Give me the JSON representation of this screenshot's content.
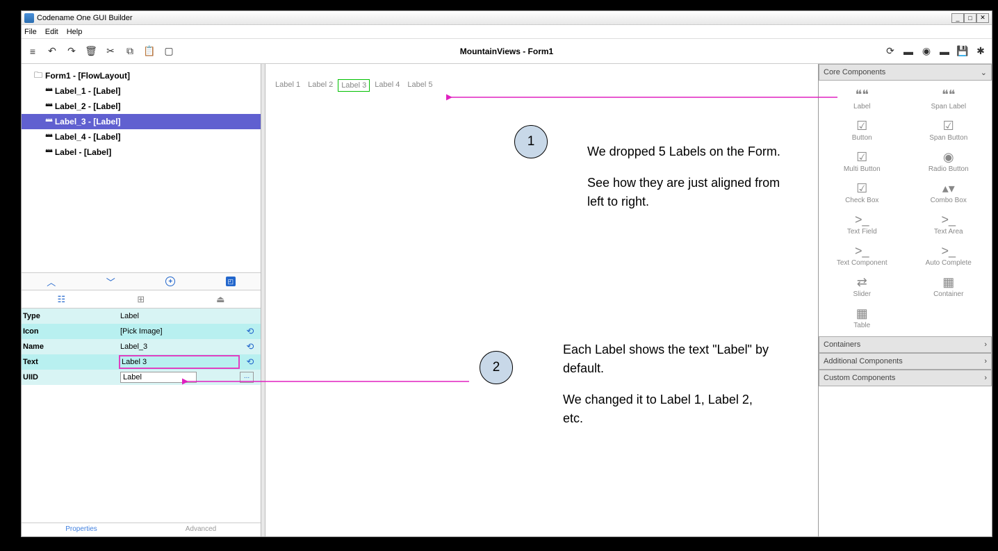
{
  "window": {
    "title": "Codename One GUI Builder"
  },
  "menu": {
    "file": "File",
    "edit": "Edit",
    "help": "Help"
  },
  "toolbar_center": "MountainViews - Form1",
  "tree": {
    "root": "Form1 - [FlowLayout]",
    "items": [
      "Label_1 - [Label]",
      "Label_2 - [Label]",
      "Label_3 - [Label]",
      "Label_4 - [Label]",
      "Label - [Label]"
    ],
    "selected_index": 2
  },
  "properties": {
    "rows": [
      {
        "key": "Type",
        "val": "Label"
      },
      {
        "key": "Icon",
        "val": "[Pick Image]",
        "action": true
      },
      {
        "key": "Name",
        "val": "Label_3",
        "action": true
      },
      {
        "key": "Text",
        "val": "Label 3",
        "boxed": true,
        "action": true
      },
      {
        "key": "UIID",
        "val_input": "Label",
        "dots": true
      }
    ],
    "footer": {
      "active": "Properties",
      "inactive": "Advanced"
    }
  },
  "canvas": {
    "labels": [
      "Label 1",
      "Label 2",
      "Label 3",
      "Label 4",
      "Label 5"
    ],
    "selected_index": 2
  },
  "palette": {
    "categories": [
      {
        "name": "Core Components",
        "open": true,
        "items": [
          {
            "label": "Label",
            "icon": "❝❝"
          },
          {
            "label": "Span Label",
            "icon": "❝❝"
          },
          {
            "label": "Button",
            "icon": "☑"
          },
          {
            "label": "Span Button",
            "icon": "☑"
          },
          {
            "label": "Multi Button",
            "icon": "☑"
          },
          {
            "label": "Radio Button",
            "icon": "◉"
          },
          {
            "label": "Check Box",
            "icon": "☑"
          },
          {
            "label": "Combo Box",
            "icon": "▴▾"
          },
          {
            "label": "Text Field",
            "icon": ">_"
          },
          {
            "label": "Text Area",
            "icon": ">_"
          },
          {
            "label": "Text Component",
            "icon": ">_"
          },
          {
            "label": "Auto Complete",
            "icon": ">_"
          },
          {
            "label": "Slider",
            "icon": "⇄"
          },
          {
            "label": "Container",
            "icon": "▦"
          },
          {
            "label": "Table",
            "icon": "▦"
          }
        ]
      },
      {
        "name": "Containers",
        "open": false
      },
      {
        "name": "Additional Components",
        "open": false
      },
      {
        "name": "Custom Components",
        "open": false
      }
    ]
  },
  "annotations": {
    "n1": "1",
    "n2": "2",
    "text1a": "We dropped 5 Labels on the Form.",
    "text1b": "See how they are just aligned from left to right.",
    "text2a": "Each Label shows the text \"Label\" by default.",
    "text2b": "We changed it to Label 1, Label 2, etc."
  }
}
